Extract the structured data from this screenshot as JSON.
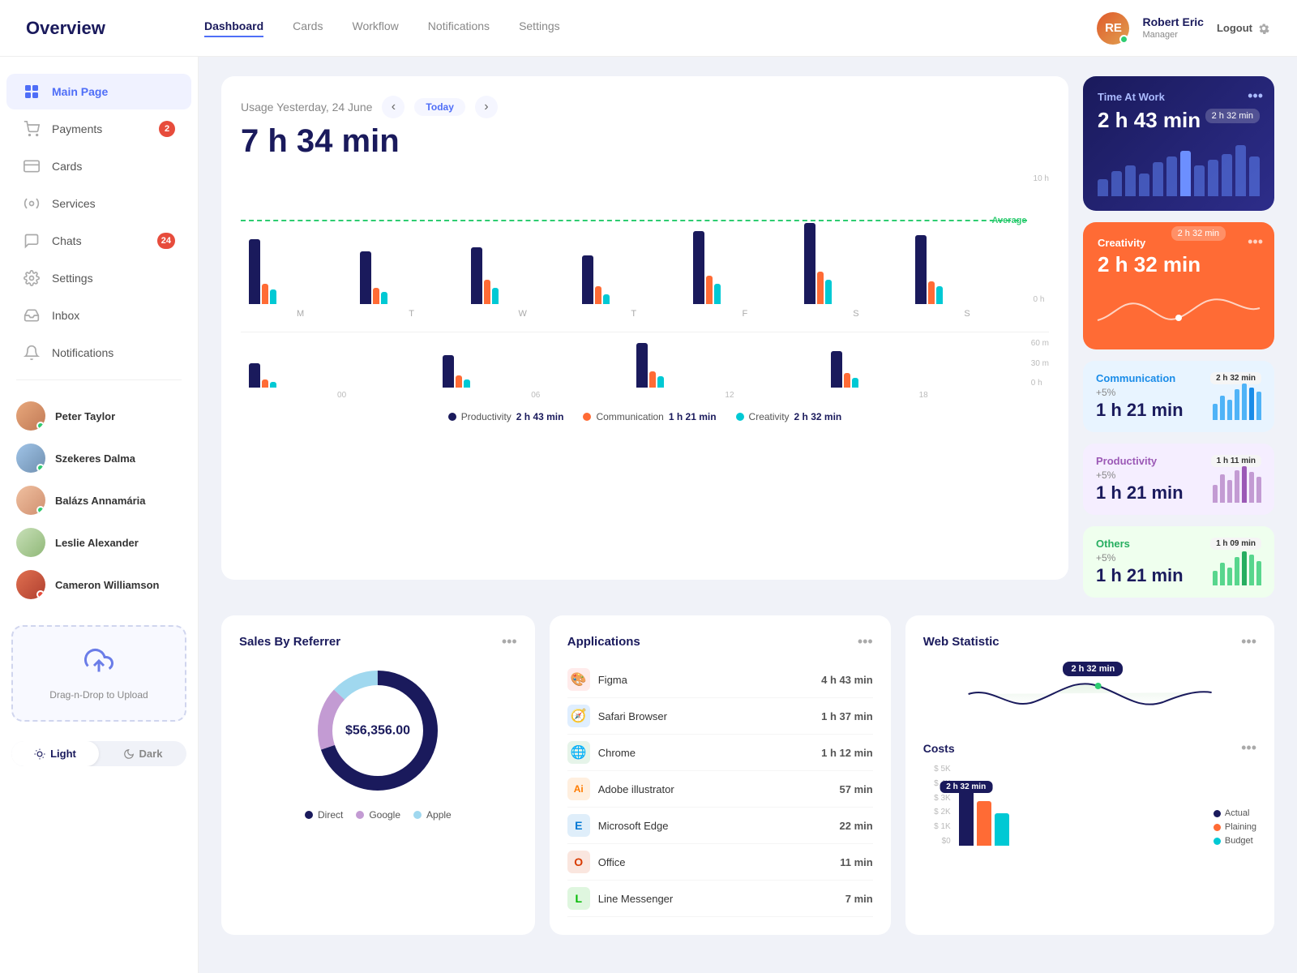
{
  "app": {
    "title": "Overview"
  },
  "topnav": {
    "logo": "Overview",
    "links": [
      {
        "label": "Dashboard",
        "active": true
      },
      {
        "label": "Cards",
        "active": false
      },
      {
        "label": "Workflow",
        "active": false
      },
      {
        "label": "Notifications",
        "active": false
      },
      {
        "label": "Settings",
        "active": false
      }
    ],
    "user": {
      "name": "Robert Eric",
      "role": "Manager",
      "initials": "RE"
    },
    "logout": "Logout"
  },
  "sidebar": {
    "nav": [
      {
        "label": "Main Page",
        "icon": "grid",
        "active": true,
        "badge": null
      },
      {
        "label": "Payments",
        "icon": "cart",
        "active": false,
        "badge": "2"
      },
      {
        "label": "Cards",
        "icon": "card",
        "active": false,
        "badge": null
      },
      {
        "label": "Services",
        "icon": "services",
        "active": false,
        "badge": null
      },
      {
        "label": "Chats",
        "icon": "chat",
        "active": false,
        "badge": "24"
      },
      {
        "label": "Settings",
        "icon": "gear",
        "active": false,
        "badge": null
      },
      {
        "label": "Inbox",
        "icon": "inbox",
        "active": false,
        "badge": null
      },
      {
        "label": "Notifications",
        "icon": "bell",
        "active": false,
        "badge": null
      }
    ],
    "contacts": [
      {
        "name": "Peter Taylor",
        "status": "green"
      },
      {
        "name": "Szekeres Dalma",
        "status": "green"
      },
      {
        "name": "Balázs Annamária",
        "status": "green"
      },
      {
        "name": "Leslie Alexander",
        "status": "none"
      },
      {
        "name": "Cameron Williamson",
        "status": "red"
      }
    ],
    "upload": {
      "label": "Drag-n-Drop to Upload"
    },
    "theme": {
      "light": "Light",
      "dark": "Dark"
    }
  },
  "usage": {
    "date_label": "Usage Yesterday, 24 June",
    "today_btn": "Today",
    "total_time": "7 h 34 min",
    "avg_label": "Average",
    "days": [
      "M",
      "T",
      "W",
      "T",
      "F",
      "S",
      "S"
    ],
    "hours": [
      "00",
      "06",
      "12",
      "18"
    ],
    "y_labels": [
      "10 h",
      "",
      "",
      "0 h"
    ],
    "y2_labels": [
      "60 m",
      "30 m",
      "0 h"
    ],
    "bars": [
      {
        "prod": 80,
        "comm": 25,
        "creat": 18
      },
      {
        "prod": 65,
        "comm": 20,
        "creat": 15
      },
      {
        "prod": 70,
        "comm": 30,
        "creat": 20
      },
      {
        "prod": 60,
        "comm": 22,
        "creat": 12
      },
      {
        "prod": 90,
        "comm": 35,
        "creat": 25
      },
      {
        "prod": 100,
        "comm": 40,
        "creat": 30
      },
      {
        "prod": 85,
        "comm": 28,
        "creat": 22
      }
    ],
    "legend": [
      {
        "label": "Productivity",
        "color": "#1a1a5c",
        "value": "2 h 43 min"
      },
      {
        "label": "Communication",
        "color": "#ff6b35",
        "value": "1 h 21 min"
      },
      {
        "label": "Creativity",
        "color": "#00c9d4",
        "value": "2 h 32 min"
      }
    ]
  },
  "time_at_work": {
    "label": "Time At Work",
    "time": "2 h 43 min",
    "tooltip": "2 h 32 min",
    "bars": [
      30,
      45,
      55,
      40,
      60,
      70,
      80,
      55,
      65,
      75,
      90,
      70
    ]
  },
  "creativity": {
    "label": "Creativity",
    "time": "2 h 32 min",
    "tooltip": "2 h 32 min"
  },
  "stats": [
    {
      "id": "comm",
      "title": "Communication",
      "pct": "+5%",
      "main": "1 h 21 min",
      "tooltip": "2 h 32 min",
      "color": "#1a8ce8",
      "bar_color": "#4fb3f7",
      "bg": "#e8f4ff"
    },
    {
      "id": "prod",
      "title": "Productivity",
      "pct": "+5%",
      "main": "1 h 21 min",
      "tooltip": "1 h 11 min",
      "color": "#9b59b6",
      "bar_color": "#c39bd3",
      "bg": "#f5eeff"
    },
    {
      "id": "others",
      "title": "Others",
      "pct": "+5%",
      "main": "1 h 21 min",
      "tooltip": "1 h 09 min",
      "color": "#27ae60",
      "bar_color": "#58d68d",
      "bg": "#efffee"
    }
  ],
  "sales": {
    "title": "Sales By Referrer",
    "total": "$56,356.00",
    "legend": [
      {
        "label": "Direct",
        "color": "#1a1a5c"
      },
      {
        "label": "Google",
        "color": "#c39bd3"
      },
      {
        "label": "Apple",
        "color": "#a0d8ef"
      }
    ]
  },
  "applications": {
    "title": "Applications",
    "items": [
      {
        "name": "Figma",
        "time": "4 h 43 min",
        "icon": "🎨",
        "color": "#ff5f5f"
      },
      {
        "name": "Safari Browser",
        "time": "1 h 37 min",
        "icon": "🧭",
        "color": "#007aff"
      },
      {
        "name": "Chrome",
        "time": "1 h 12 min",
        "icon": "🌐",
        "color": "#34a853"
      },
      {
        "name": "Adobe illustrator",
        "time": "57 min",
        "icon": "Ai",
        "color": "#ff7c00"
      },
      {
        "name": "Microsoft Edge",
        "time": "22 min",
        "icon": "E",
        "color": "#0078d4"
      },
      {
        "name": "Office",
        "time": "11 min",
        "icon": "O",
        "color": "#d83b01"
      },
      {
        "name": "Line Messenger",
        "time": "7 min",
        "icon": "L",
        "color": "#00b900"
      }
    ]
  },
  "webstat": {
    "title": "Web Statistic",
    "tooltip": "2 h 32 min",
    "costs": {
      "title": "Costs",
      "y_labels": [
        "$ 5K",
        "$ 4K",
        "$ 3K",
        "$ 2K",
        "$ 1K",
        "$0"
      ],
      "tooltip": "2 h 32 min",
      "legend": [
        {
          "label": "Actual",
          "color": "#1a1a5c"
        },
        {
          "label": "Plaining",
          "color": "#ff6b35"
        },
        {
          "label": "Budget",
          "color": "#00c9d4"
        }
      ]
    }
  }
}
